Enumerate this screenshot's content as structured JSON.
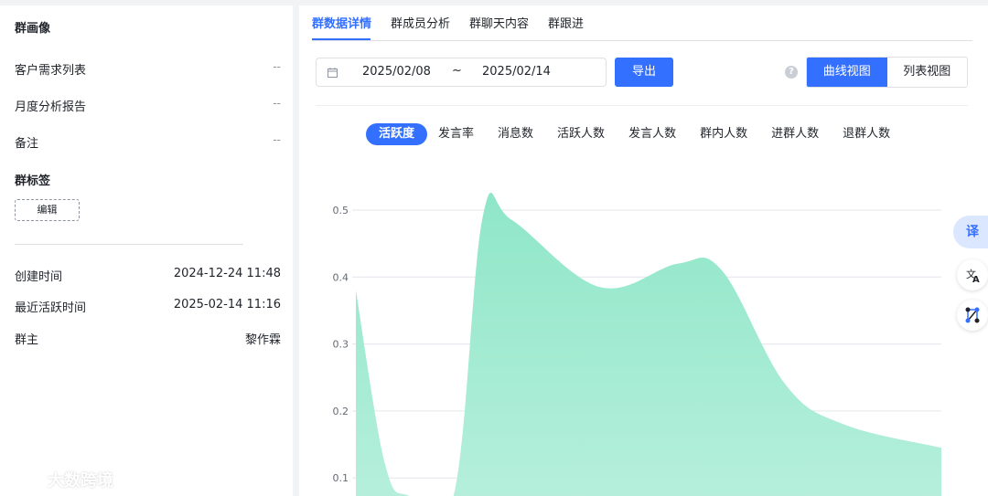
{
  "left_panel": {
    "group_profile_title": "群画像",
    "rows": [
      {
        "label": "客户需求列表",
        "value": "--"
      },
      {
        "label": "月度分析报告",
        "value": "--"
      },
      {
        "label": "备注",
        "value": "--"
      }
    ],
    "group_tags_title": "群标签",
    "edit_button": "编辑",
    "info_rows": [
      {
        "label": "创建时间",
        "value": "2024-12-24 11:48"
      },
      {
        "label": "最近活跃时间",
        "value": "2025-02-14 11:16"
      },
      {
        "label": "群主",
        "value": "黎作霖"
      }
    ]
  },
  "tabs": [
    {
      "label": "群数据详情",
      "active": true
    },
    {
      "label": "群成员分析",
      "active": false
    },
    {
      "label": "群聊天内容",
      "active": false
    },
    {
      "label": "群跟进",
      "active": false
    }
  ],
  "toolbar": {
    "date_start": "2025/02/08",
    "date_separator": "~",
    "date_end": "2025/02/14",
    "export_label": "导出",
    "view_curve": "曲线视图",
    "view_list": "列表视图",
    "help_symbol": "?"
  },
  "metrics": [
    {
      "label": "活跃度",
      "active": true
    },
    {
      "label": "发言率",
      "active": false
    },
    {
      "label": "消息数",
      "active": false
    },
    {
      "label": "活跃人数",
      "active": false
    },
    {
      "label": "发言人数",
      "active": false
    },
    {
      "label": "群内人数",
      "active": false
    },
    {
      "label": "进群人数",
      "active": false
    },
    {
      "label": "退群人数",
      "active": false
    }
  ],
  "chart_data": {
    "type": "area",
    "y_ticks": [
      "0.5",
      "0.4",
      "0.3",
      "0.2",
      "0.1"
    ],
    "ylim": [
      0,
      0.5
    ],
    "x_range": [
      0,
      6
    ],
    "series": [
      {
        "color": "#9ee8cf",
        "points": [
          [
            0.0,
            0.38
          ],
          [
            0.3,
            0.12
          ],
          [
            0.55,
            0.0
          ],
          [
            1.0,
            0.0
          ],
          [
            1.3,
            0.49
          ],
          [
            1.6,
            0.485
          ],
          [
            2.5,
            0.385
          ],
          [
            3.3,
            0.42
          ],
          [
            3.75,
            0.41
          ],
          [
            4.4,
            0.24
          ],
          [
            5.0,
            0.18
          ],
          [
            6.0,
            0.145
          ]
        ]
      }
    ],
    "grid": true,
    "legend": "none"
  },
  "dock": {
    "translate_label": "译"
  },
  "watermark": {
    "text": "大数跨境"
  }
}
